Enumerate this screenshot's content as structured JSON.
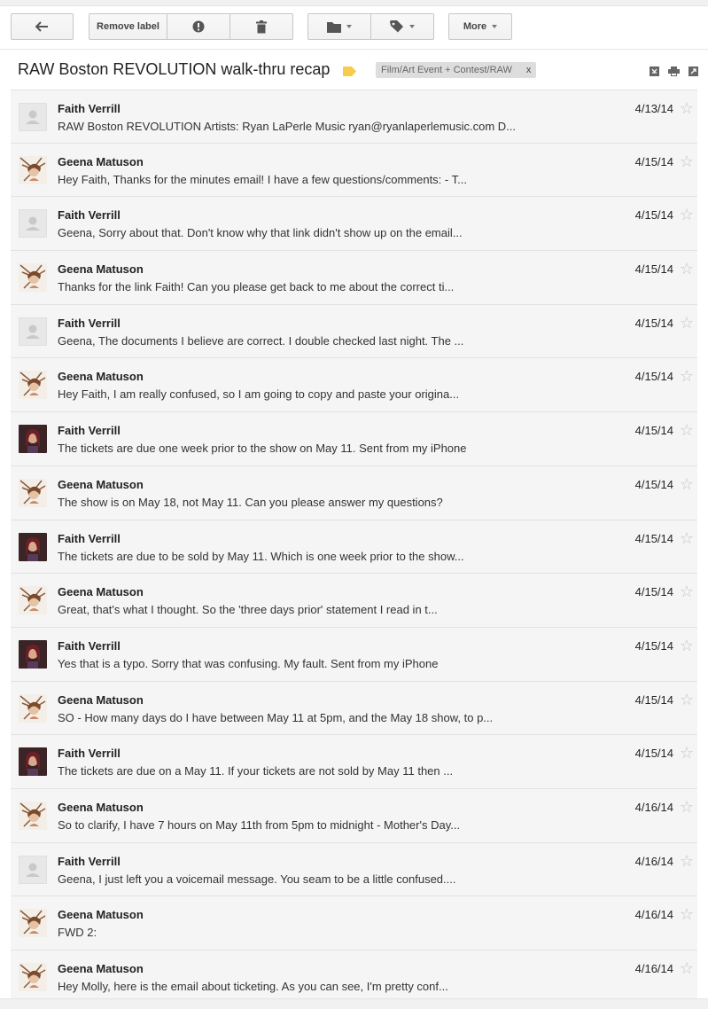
{
  "toolbar": {
    "back_icon": "back-arrow-icon",
    "remove_label": "Remove label",
    "report_icon": "report-spam-icon",
    "delete_icon": "trash-icon",
    "move_icon": "folder-icon",
    "labels_icon": "tag-icon",
    "more_label": "More"
  },
  "header": {
    "subject": "RAW Boston REVOLUTION walk-thru recap",
    "label_text": "Film/Art Event + Contest/RAW",
    "label_close": "x",
    "label_color": "#f7cb4d"
  },
  "messages": [
    {
      "sender": "Faith Verrill",
      "snippet": "RAW Boston REVOLUTION Artists: Ryan LaPerle Music ryan@ryanlaperlemusic.com D...",
      "date": "4/13/14",
      "avatar": "default"
    },
    {
      "sender": "Geena Matuson",
      "snippet": "Hey Faith, Thanks for the minutes email! I have a few questions/comments: - T...",
      "date": "4/15/14",
      "avatar": "geena"
    },
    {
      "sender": "Faith Verrill",
      "snippet": "Geena, Sorry about that. Don't know why that link didn't show up on the email...",
      "date": "4/15/14",
      "avatar": "default"
    },
    {
      "sender": "Geena Matuson",
      "snippet": "Thanks for the link Faith! Can you please get back to me about the correct ti...",
      "date": "4/15/14",
      "avatar": "geena"
    },
    {
      "sender": "Faith Verrill",
      "snippet": "Geena, The documents I believe are correct. I double checked last night. The ...",
      "date": "4/15/14",
      "avatar": "default"
    },
    {
      "sender": "Geena Matuson",
      "snippet": "Hey Faith, I am really confused, so I am going to copy and paste your origina...",
      "date": "4/15/14",
      "avatar": "geena"
    },
    {
      "sender": "Faith Verrill",
      "snippet": "The tickets are due one week prior to the show on May 11. Sent from my iPhone",
      "date": "4/15/14",
      "avatar": "faith"
    },
    {
      "sender": "Geena Matuson",
      "snippet": "The show is on May 18, not May 11. Can you please answer my questions?",
      "date": "4/15/14",
      "avatar": "geena"
    },
    {
      "sender": "Faith Verrill",
      "snippet": "The tickets are due to be sold by May 11. Which is one week prior to the show...",
      "date": "4/15/14",
      "avatar": "faith"
    },
    {
      "sender": "Geena Matuson",
      "snippet": "Great, that's what I thought. So the 'three days prior' statement I read in t...",
      "date": "4/15/14",
      "avatar": "geena"
    },
    {
      "sender": "Faith Verrill",
      "snippet": "Yes that is a typo. Sorry that was confusing. My fault. Sent from my iPhone",
      "date": "4/15/14",
      "avatar": "faith"
    },
    {
      "sender": "Geena Matuson",
      "snippet": "SO - How many days do I have between May 11 at 5pm, and the May 18 show, to p...",
      "date": "4/15/14",
      "avatar": "geena"
    },
    {
      "sender": "Faith Verrill",
      "snippet": "The tickets are due on a May 11. If your tickets are not sold by May 11 then ...",
      "date": "4/15/14",
      "avatar": "faith"
    },
    {
      "sender": "Geena Matuson",
      "snippet": "So to clarify, I have 7 hours on May 11th from 5pm to midnight - Mother's Day...",
      "date": "4/16/14",
      "avatar": "geena"
    },
    {
      "sender": "Faith Verrill",
      "snippet": "Geena, I just left you a voicemail message. You seam to be a little confused....",
      "date": "4/16/14",
      "avatar": "default"
    },
    {
      "sender": "Geena Matuson",
      "snippet": "FWD 2:",
      "date": "4/16/14",
      "avatar": "geena"
    },
    {
      "sender": "Geena Matuson",
      "snippet": "Hey Molly, here is the email about ticketing. As you can see, I'm pretty conf...",
      "date": "4/16/14",
      "avatar": "geena"
    }
  ]
}
